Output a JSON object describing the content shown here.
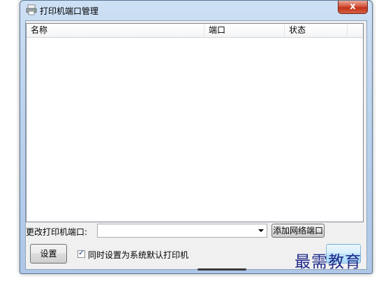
{
  "window": {
    "title": "打印机端口管理",
    "close_glyph": "x"
  },
  "list": {
    "columns": [
      "名称",
      "端口",
      "状态"
    ]
  },
  "port_change": {
    "label": "更改打印机端口:",
    "combo_value": "",
    "add_button_label": "添加网络端口"
  },
  "bottom": {
    "settings_button_label": "设置",
    "default_checkbox_label": "同时设置为系统默认打印机",
    "default_checked": true,
    "ok_button_label": ""
  },
  "watermark": {
    "text": "最需教育"
  }
}
